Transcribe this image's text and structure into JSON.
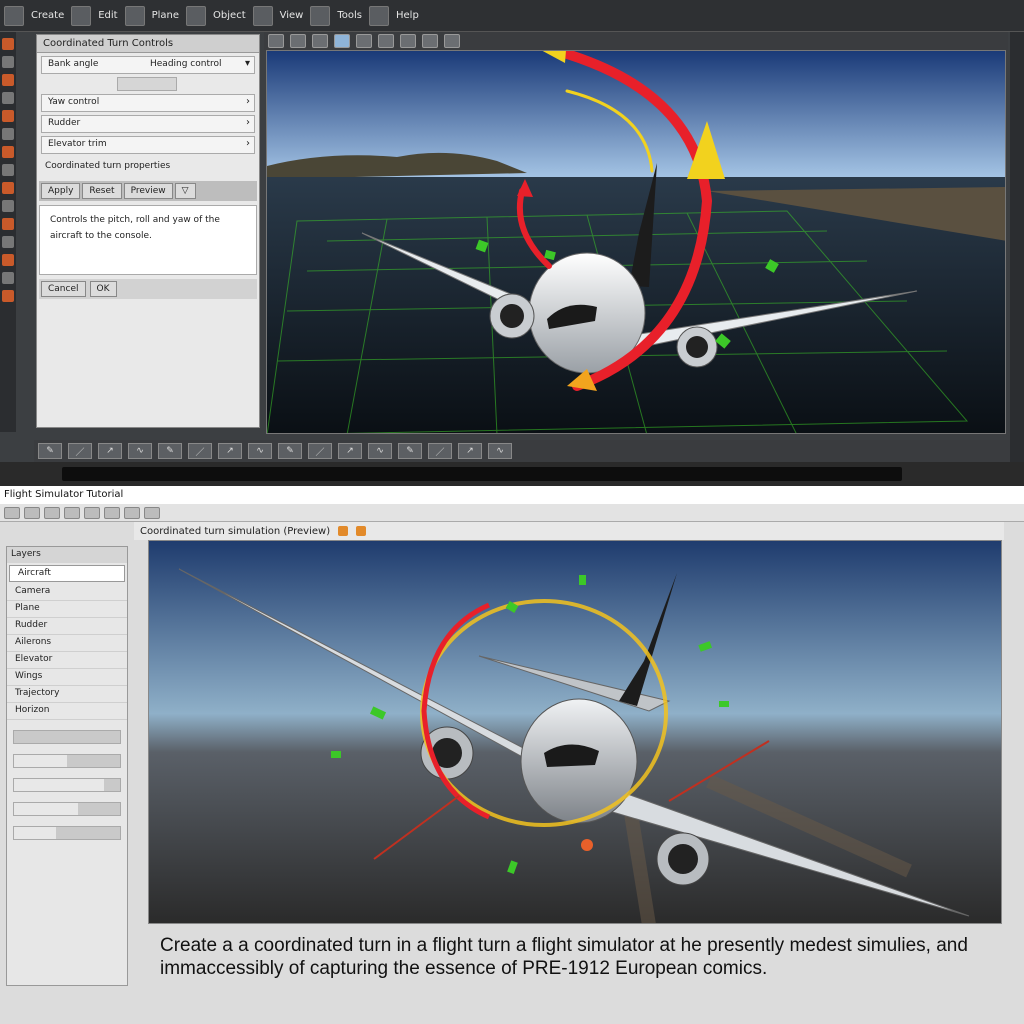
{
  "top_app": {
    "toolbar": [
      "Create",
      "Edit",
      "Plane",
      "Object",
      "View",
      "Tools",
      "Help"
    ],
    "panel": {
      "title": "Coordinated Turn Controls",
      "rows": [
        {
          "label": "Bank angle",
          "value": "Heading control"
        },
        {
          "label": "Yaw control",
          "value": ""
        },
        {
          "label": "Rudder",
          "value": ""
        },
        {
          "label": "Elevator trim",
          "value": ""
        }
      ],
      "section_label": "Coordinated turn properties",
      "buttons": [
        "Apply",
        "Reset",
        "Preview"
      ],
      "description": "Controls the pitch, roll and yaw of the aircraft to the console.",
      "footer_buttons": [
        "Cancel",
        "OK"
      ]
    },
    "bottom_bar_icons": [
      "pen",
      "line",
      "arrow",
      "curve",
      "pen",
      "line",
      "arrow",
      "curve"
    ]
  },
  "bottom_app": {
    "title": "Flight Simulator Tutorial",
    "viewport_header": "Coordinated turn simulation (Preview)",
    "layers": {
      "title": "Layers",
      "search_value": "Aircraft",
      "items": [
        "Camera",
        "Plane",
        "Rudder",
        "Ailerons",
        "Elevator",
        "Wings",
        "Trajectory",
        "Horizon"
      ]
    },
    "slider_values": [
      0.0,
      0.5,
      0.85,
      0.6,
      0.4
    ],
    "caption": "Create a a coordinated turn in a flight turn a flight simulator at he presently medest simulies, and immaccessibly of capturing the essence of PRE-1912 European comics."
  },
  "colors": {
    "arrow_red": "#e8202a",
    "arrow_yellow": "#f2d21e",
    "grid_green": "#3cc828",
    "sky_top": "#1a3a78",
    "sky_bottom": "#a8c8e8",
    "accent_orange": "#c95a2a"
  }
}
